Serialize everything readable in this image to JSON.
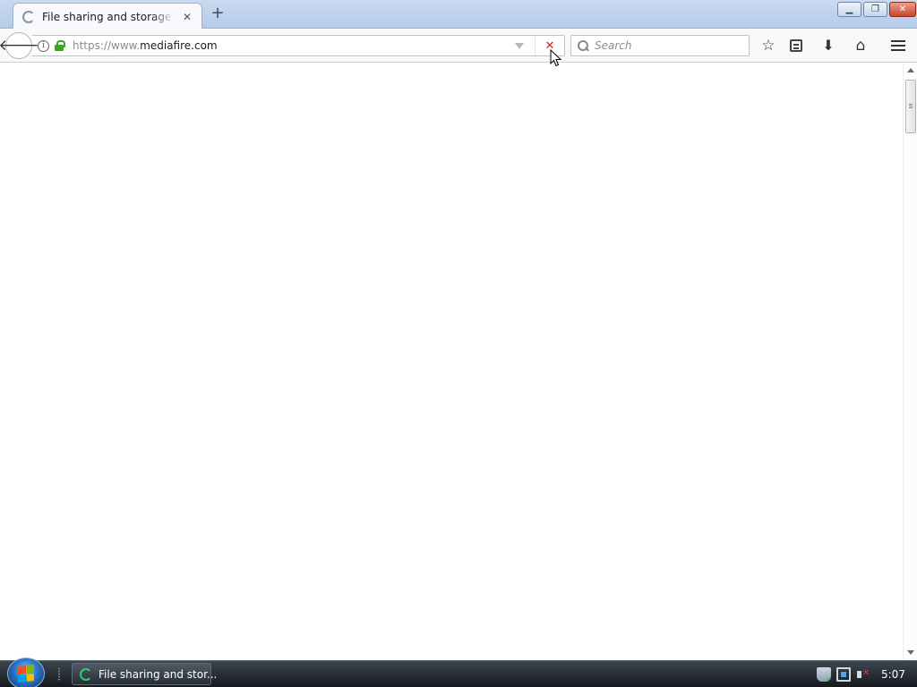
{
  "browser": {
    "tab": {
      "title": "File sharing and storage made simple",
      "close_glyph": "✕"
    },
    "new_tab_glyph": "+",
    "window_controls": {
      "minimize_glyph": "▁",
      "maximize_glyph": "❐",
      "close_glyph": "✕"
    },
    "nav": {
      "back_glyph": "🡐",
      "url_scheme": "https://www.",
      "url_host": "mediafire.com",
      "stop_glyph": "✕",
      "search_placeholder": "Search"
    },
    "toolbar_icons": [
      "star-icon",
      "library-icon",
      "download-icon",
      "home-icon",
      "menu-icon"
    ],
    "toolbar_glyphs": {
      "star": "☆",
      "download": "⬇",
      "home": "⌂"
    }
  },
  "taskbar": {
    "task_label": "File sharing and stor...",
    "clock": "5:07"
  },
  "colors": {
    "lock": "#3fa32a",
    "stop": "#d11d1d",
    "taskbar": "#15191e"
  }
}
